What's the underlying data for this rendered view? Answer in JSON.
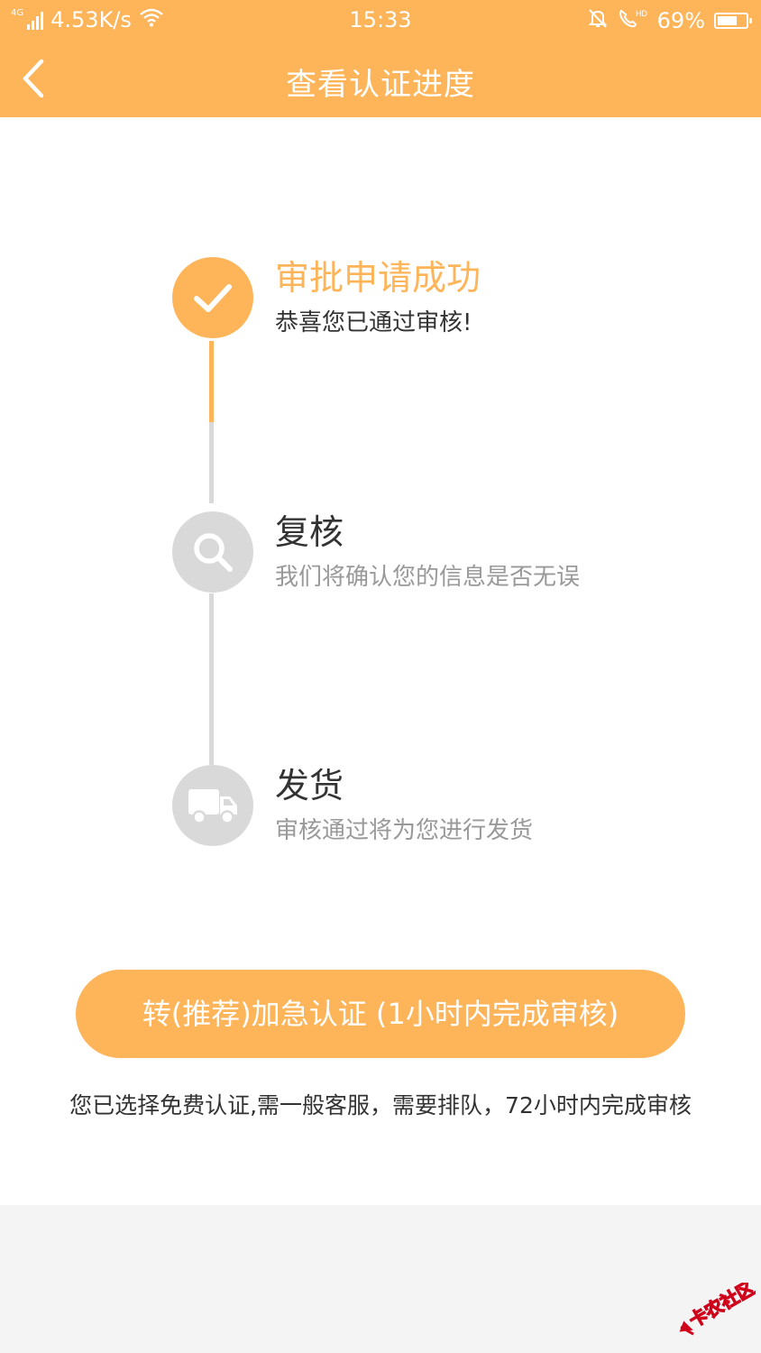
{
  "status_bar": {
    "network_type": "4G",
    "speed": "4.53K/s",
    "time": "15:33",
    "battery_percent": "69%",
    "battery_level": 0.69
  },
  "header": {
    "title": "查看认证进度",
    "bg_color": "#feb458"
  },
  "steps": [
    {
      "title": "审批申请成功",
      "desc": "恭喜您已通过审核!",
      "status": "done",
      "icon": "check-icon"
    },
    {
      "title": "复核",
      "desc": "我们将确认您的信息是否无误",
      "status": "pending",
      "icon": "search-icon"
    },
    {
      "title": "发货",
      "desc": "审核通过将为您进行发货",
      "status": "pending",
      "icon": "truck-icon"
    }
  ],
  "cta": {
    "label": "转(推荐)加急认证 (1小时内完成审核)"
  },
  "note": "您已选择免费认证,需一般客服，需要排队，72小时内完成审核",
  "watermark": {
    "text": "卡农社区"
  },
  "colors": {
    "accent": "#feb458",
    "inactive": "#d9d9d9",
    "title_text": "#333333",
    "desc_text": "#999999"
  }
}
